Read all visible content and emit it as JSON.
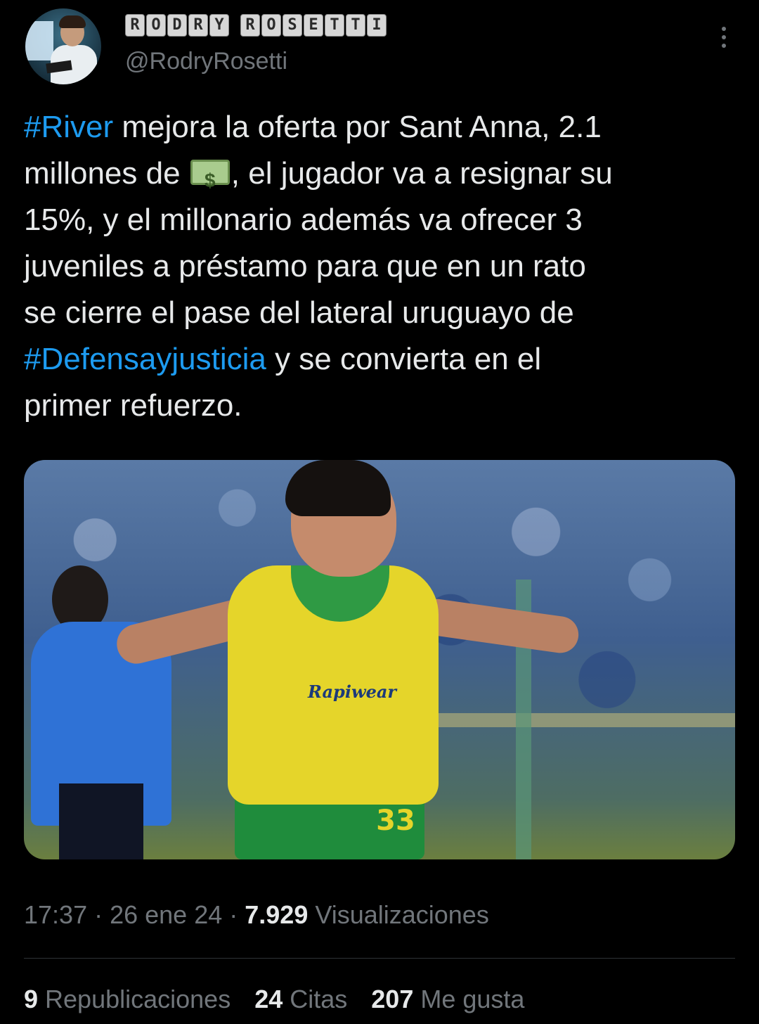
{
  "author": {
    "display_name_words": [
      [
        "R",
        "O",
        "D",
        "R",
        "Y"
      ],
      [
        "R",
        "O",
        "S",
        "E",
        "T",
        "T",
        "I"
      ]
    ],
    "handle": "@RodryRosetti"
  },
  "tweet": {
    "segments": [
      {
        "text": "#River",
        "type": "hashtag"
      },
      {
        "text": " mejora la oferta por Sant Anna, 2.1\nmillones de ",
        "type": "text"
      },
      {
        "emoji": "money-bill-icon",
        "type": "emoji"
      },
      {
        "text": ", el jugador va a resignar su\n15%, y el millonario además va ofrecer 3\njuveniles a préstamo para que en un rato\nse cierre el pase del lateral uruguayo de\n",
        "type": "text"
      },
      {
        "text": "#Defensayjusticia",
        "type": "hashtag"
      },
      {
        "text": " y se convierta en el\nprimer refuerzo.",
        "type": "text"
      }
    ]
  },
  "photo": {
    "jersey_sponsor": "Rapiwear",
    "jersey_number": "33"
  },
  "meta": {
    "time": "17:37",
    "sep1": " · ",
    "date": "26 ene 24",
    "sep2": " · ",
    "views": "7.929",
    "views_label": " Visualizaciones"
  },
  "stats": [
    {
      "count": "9",
      "label": "Republicaciones"
    },
    {
      "count": "24",
      "label": "Citas"
    },
    {
      "count": "207",
      "label": "Me gusta"
    }
  ],
  "colors": {
    "background": "#000000",
    "text": "#e7e9ea",
    "secondary": "#71767b",
    "link": "#1d9bf0",
    "divider": "#2f3336"
  }
}
